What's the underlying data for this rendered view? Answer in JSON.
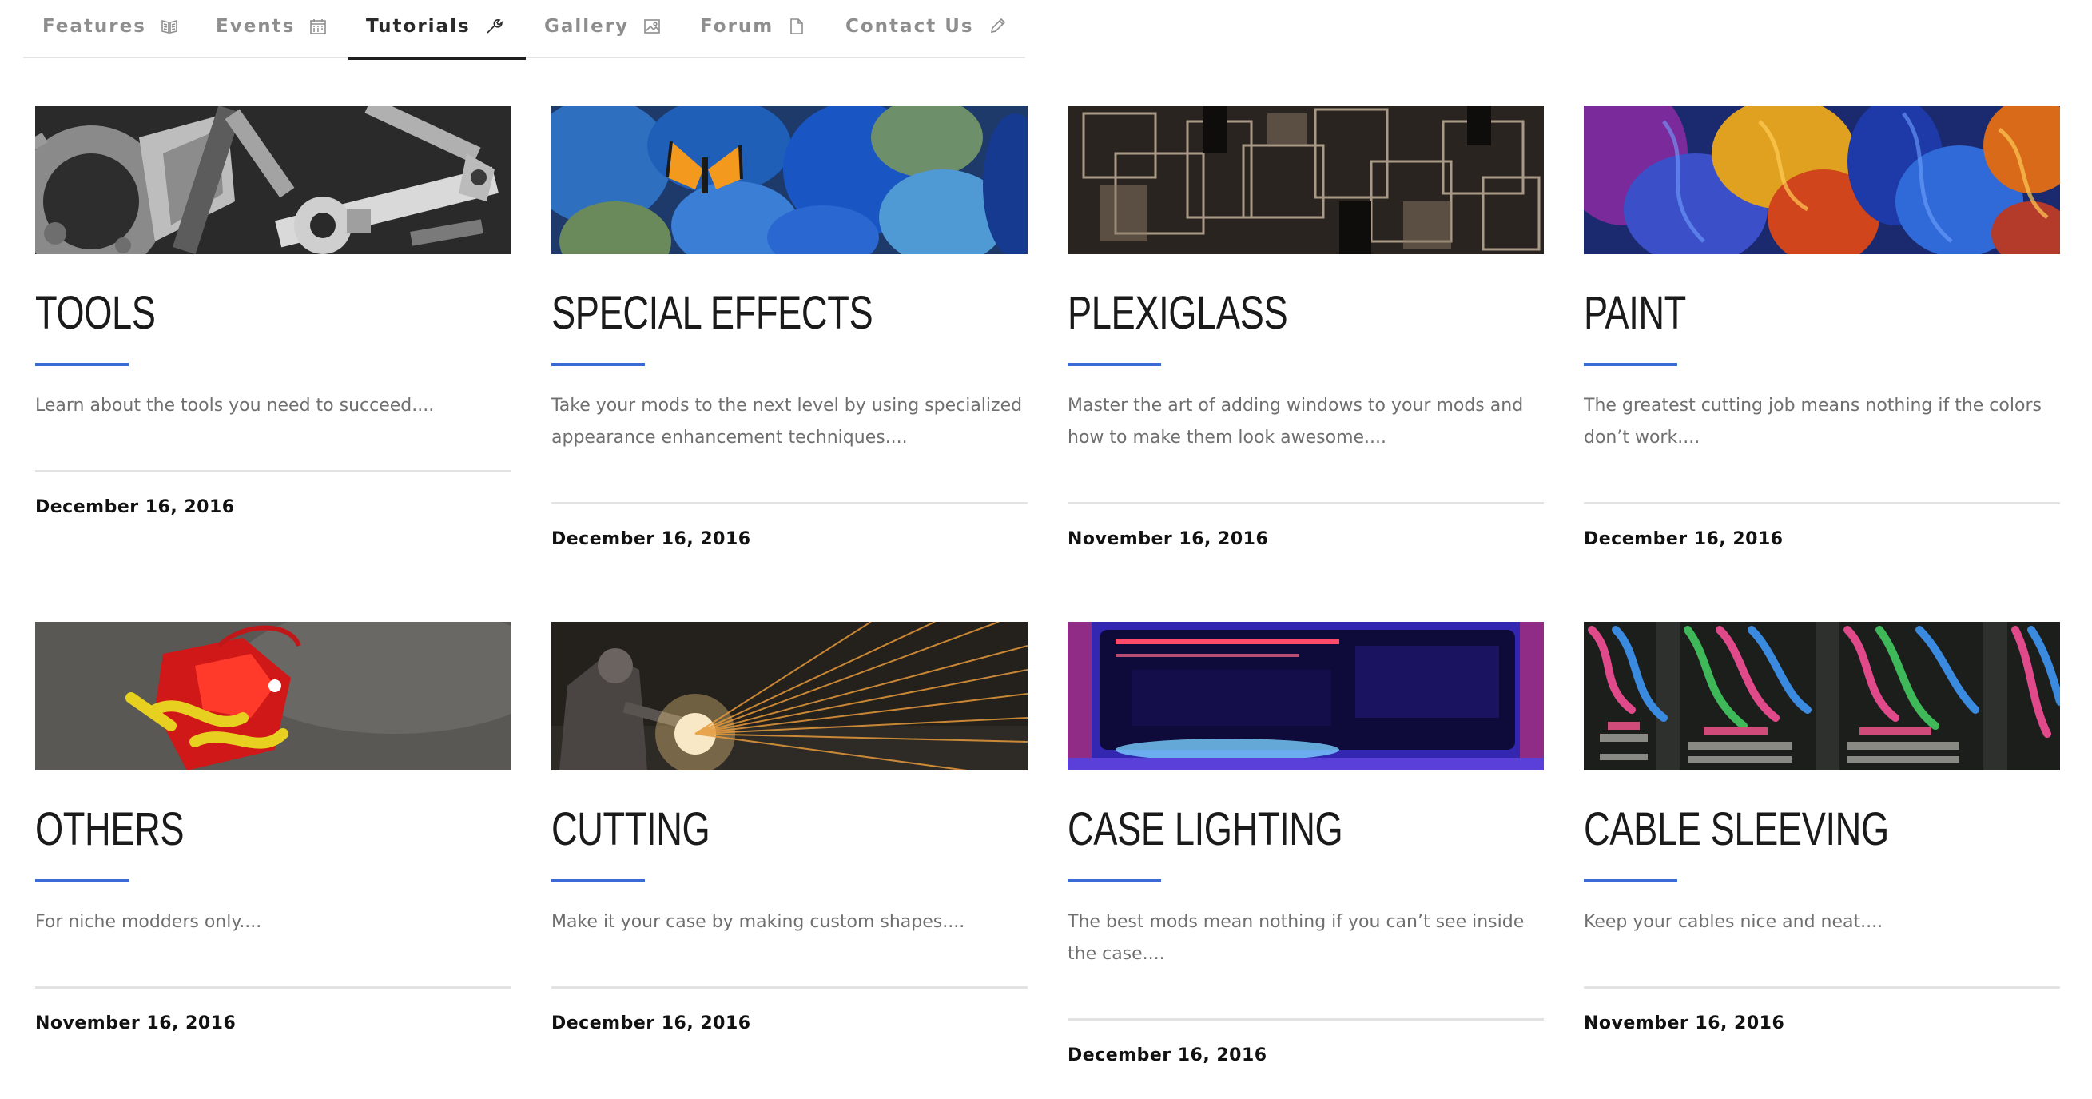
{
  "tabs": [
    {
      "label": "Features",
      "icon": "book-icon"
    },
    {
      "label": "Events",
      "icon": "calendar-icon"
    },
    {
      "label": "Tutorials",
      "icon": "wrench-icon",
      "active": true
    },
    {
      "label": "Gallery",
      "icon": "image-icon"
    },
    {
      "label": "Forum",
      "icon": "document-icon"
    },
    {
      "label": "Contact Us",
      "icon": "pencil-icon"
    }
  ],
  "colors": {
    "accent": "#3a6ad6",
    "tab_inactive": "#8e8e8e",
    "tab_active": "#2a2a2a"
  },
  "cards": [
    {
      "title": "TOOLS",
      "description": "Learn about the tools you need to succeed....",
      "date": "December 16, 2016",
      "image": "tools-image"
    },
    {
      "title": "SPECIAL EFFECTS",
      "description": "Take your mods to the next level by using specialized appearance enhancement techniques....",
      "date": "December 16, 2016",
      "image": "butterfly-stones-image"
    },
    {
      "title": "PLEXIGLASS",
      "description": "Master the art of adding windows to your mods and how to make them look awesome....",
      "date": "November 16, 2016",
      "image": "glass-structure-image"
    },
    {
      "title": "PAINT",
      "description": "The greatest cutting job means nothing if the colors don’t work....",
      "date": "December 16, 2016",
      "image": "paint-swirls-image"
    },
    {
      "title": "OTHERS",
      "description": "For niche modders only....",
      "date": "November 16, 2016",
      "image": "red-device-image"
    },
    {
      "title": "CUTTING",
      "description": "Make it your case by making custom shapes....",
      "date": "December 16, 2016",
      "image": "welding-sparks-image"
    },
    {
      "title": "CASE LIGHTING",
      "description": "The best mods mean nothing if you can’t see inside the case....",
      "date": "December 16, 2016",
      "image": "lit-case-image"
    },
    {
      "title": "CABLE SLEEVING",
      "description": "Keep your cables nice and neat....",
      "date": "November 16, 2016",
      "image": "sleeved-cables-image"
    }
  ]
}
